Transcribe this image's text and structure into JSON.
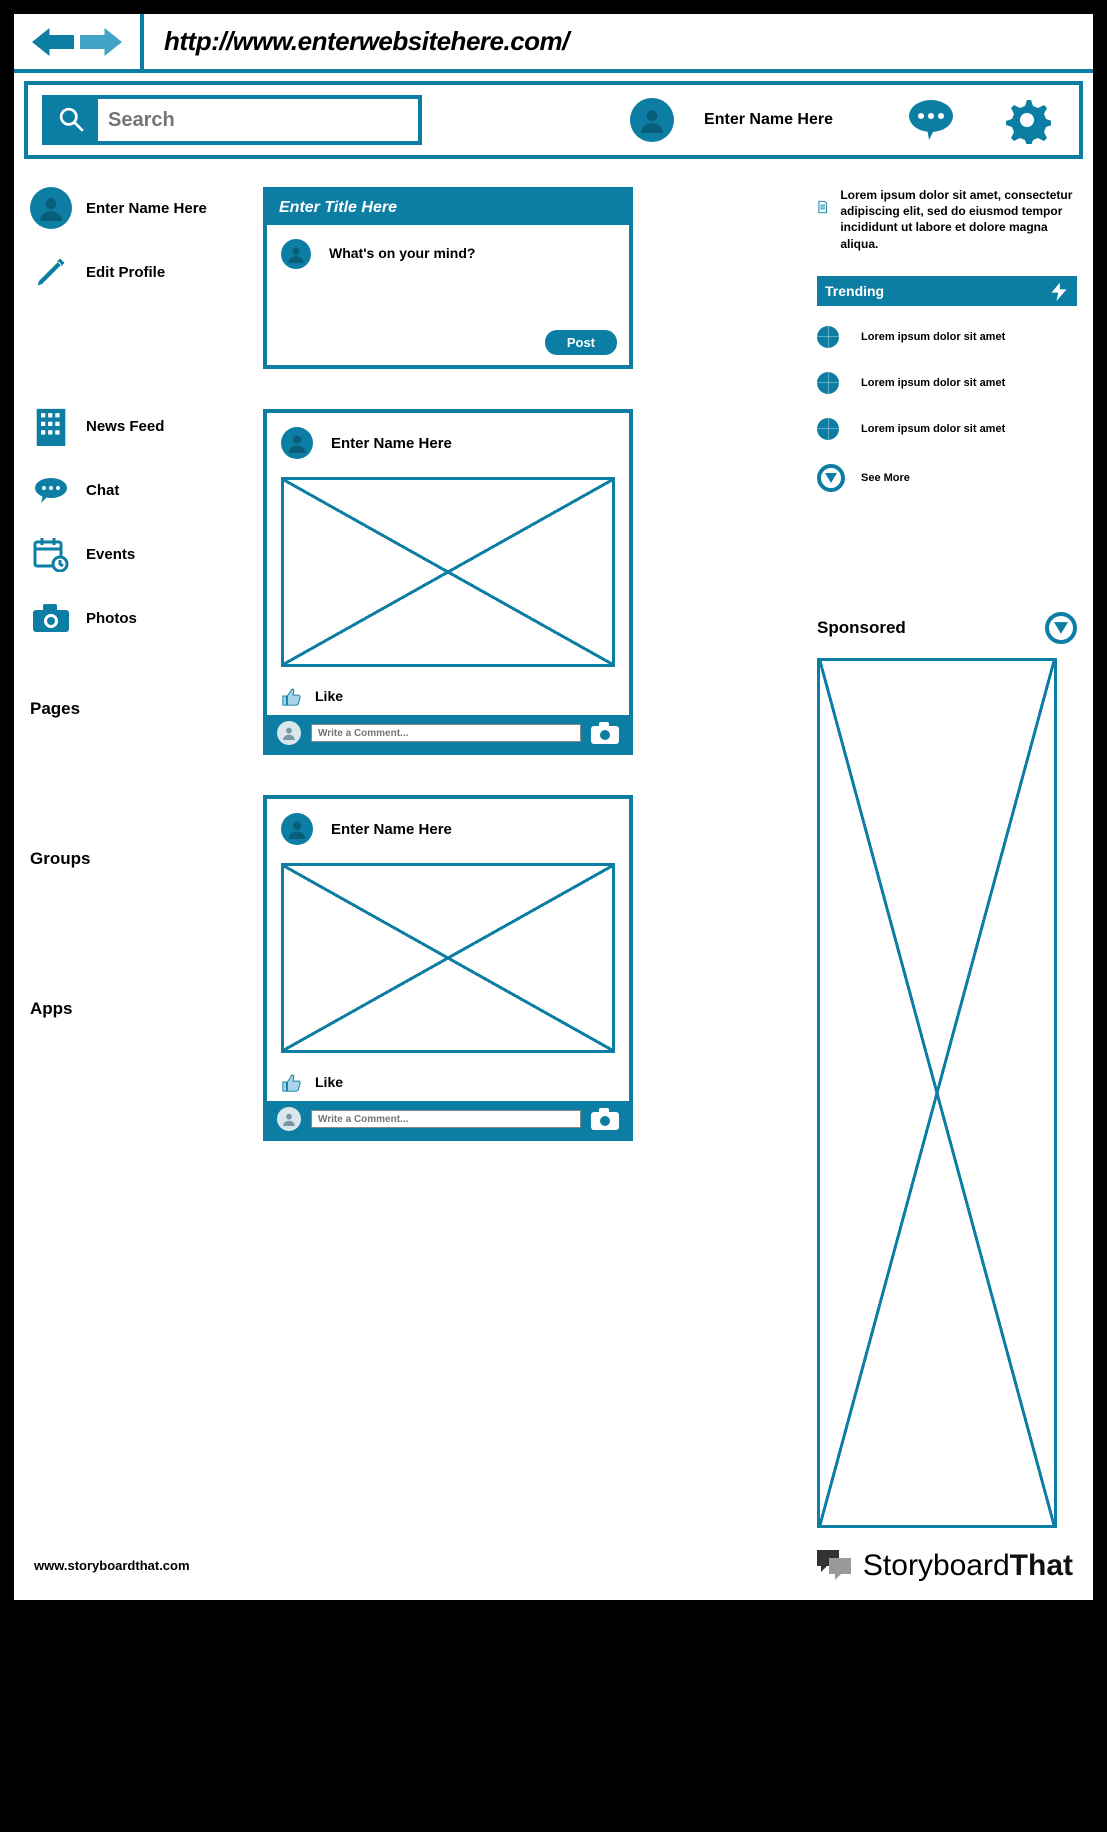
{
  "browser": {
    "url": "http://www.enterwebsitehere.com/"
  },
  "topbar": {
    "search_placeholder": "Search",
    "user_name": "Enter Name Here"
  },
  "sidebar": {
    "profile_name": "Enter Name Here",
    "edit_profile": "Edit Profile",
    "items": [
      {
        "label": "News Feed"
      },
      {
        "label": "Chat"
      },
      {
        "label": "Events"
      },
      {
        "label": "Photos"
      }
    ],
    "sections": [
      {
        "label": "Pages"
      },
      {
        "label": "Groups"
      },
      {
        "label": "Apps"
      }
    ]
  },
  "composer": {
    "title": "Enter Title Here",
    "prompt": "What's on your mind?",
    "post_button": "Post"
  },
  "feed": {
    "posts": [
      {
        "author": "Enter Name Here",
        "like_label": "Like",
        "comment_placeholder": "Write a Comment..."
      },
      {
        "author": "Enter Name Here",
        "like_label": "Like",
        "comment_placeholder": "Write a Comment..."
      }
    ]
  },
  "rightcol": {
    "info_text": "Lorem ipsum dolor sit amet, consectetur adipiscing elit, sed do eiusmod tempor incididunt ut labore et dolore magna aliqua.",
    "trending_title": "Trending",
    "trending_items": [
      {
        "label": "Lorem ipsum dolor sit amet"
      },
      {
        "label": "Lorem ipsum dolor sit amet"
      },
      {
        "label": "Lorem ipsum dolor sit amet"
      }
    ],
    "see_more": "See More",
    "sponsored_label": "Sponsored"
  },
  "footer": {
    "url": "www.storyboardthat.com",
    "brand1": "Storyboard",
    "brand2": "That"
  }
}
